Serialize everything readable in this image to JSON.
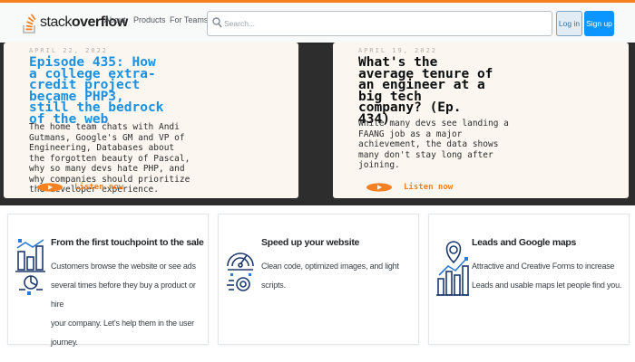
{
  "header": {
    "logo_plain": "stack",
    "logo_bold": "overflow",
    "nav": [
      "About",
      "Products",
      "For Teams"
    ],
    "search_placeholder": "Search...",
    "login": "Log in",
    "signup": "Sign up"
  },
  "podcasts": [
    {
      "date": "APRIL 22, 2022",
      "title_lines": [
        "Episode 435: How",
        "a college extra-",
        "credit project",
        "became PHP3,",
        "still the bedrock",
        "of the web"
      ],
      "title_color": "#1a90e0",
      "desc_lines": [
        "The home team chats with Andi",
        "Gutmans, Google's GM and VP of",
        "Engineering, Databases about",
        "the forgotten beauty of Pascal,",
        "why so many devs hate PHP, and",
        "why companies should prioritize",
        "the developer experience."
      ],
      "listen": "Listen now"
    },
    {
      "date": "APRIL 19, 2022",
      "title_lines": [
        "What's the",
        "average tenure of",
        "an engineer at a",
        "big tech",
        "company? (Ep.",
        "434)"
      ],
      "title_color": "#0c0d0e",
      "desc_lines": [
        "While many devs see landing a",
        "FAANG job as a major",
        "achievement, the data shows",
        "many don't stay long after",
        "joining."
      ],
      "listen": "Listen now"
    }
  ],
  "features": [
    {
      "icon": "analytics-chart-icon",
      "title": "From the first touchpoint to the sale",
      "lines": [
        "Customers browse the website or see ads",
        "several times before they buy a product or hire",
        "your company. Let's help them in the user",
        "journey."
      ]
    },
    {
      "icon": "speed-gauge-icon",
      "title": "Speed up your website",
      "lines": [
        "Clean code, optimized images, and light",
        "scripts."
      ]
    },
    {
      "icon": "map-pin-chart-icon",
      "title": "Leads and Google maps",
      "lines": [
        "Attractive and Creative Forms to increase",
        "Leads and usable maps let people find you."
      ]
    }
  ],
  "colors": {
    "accent_orange": "#f48024",
    "signup_blue": "#0a95ff",
    "icon_navy": "#1e3a6e"
  }
}
